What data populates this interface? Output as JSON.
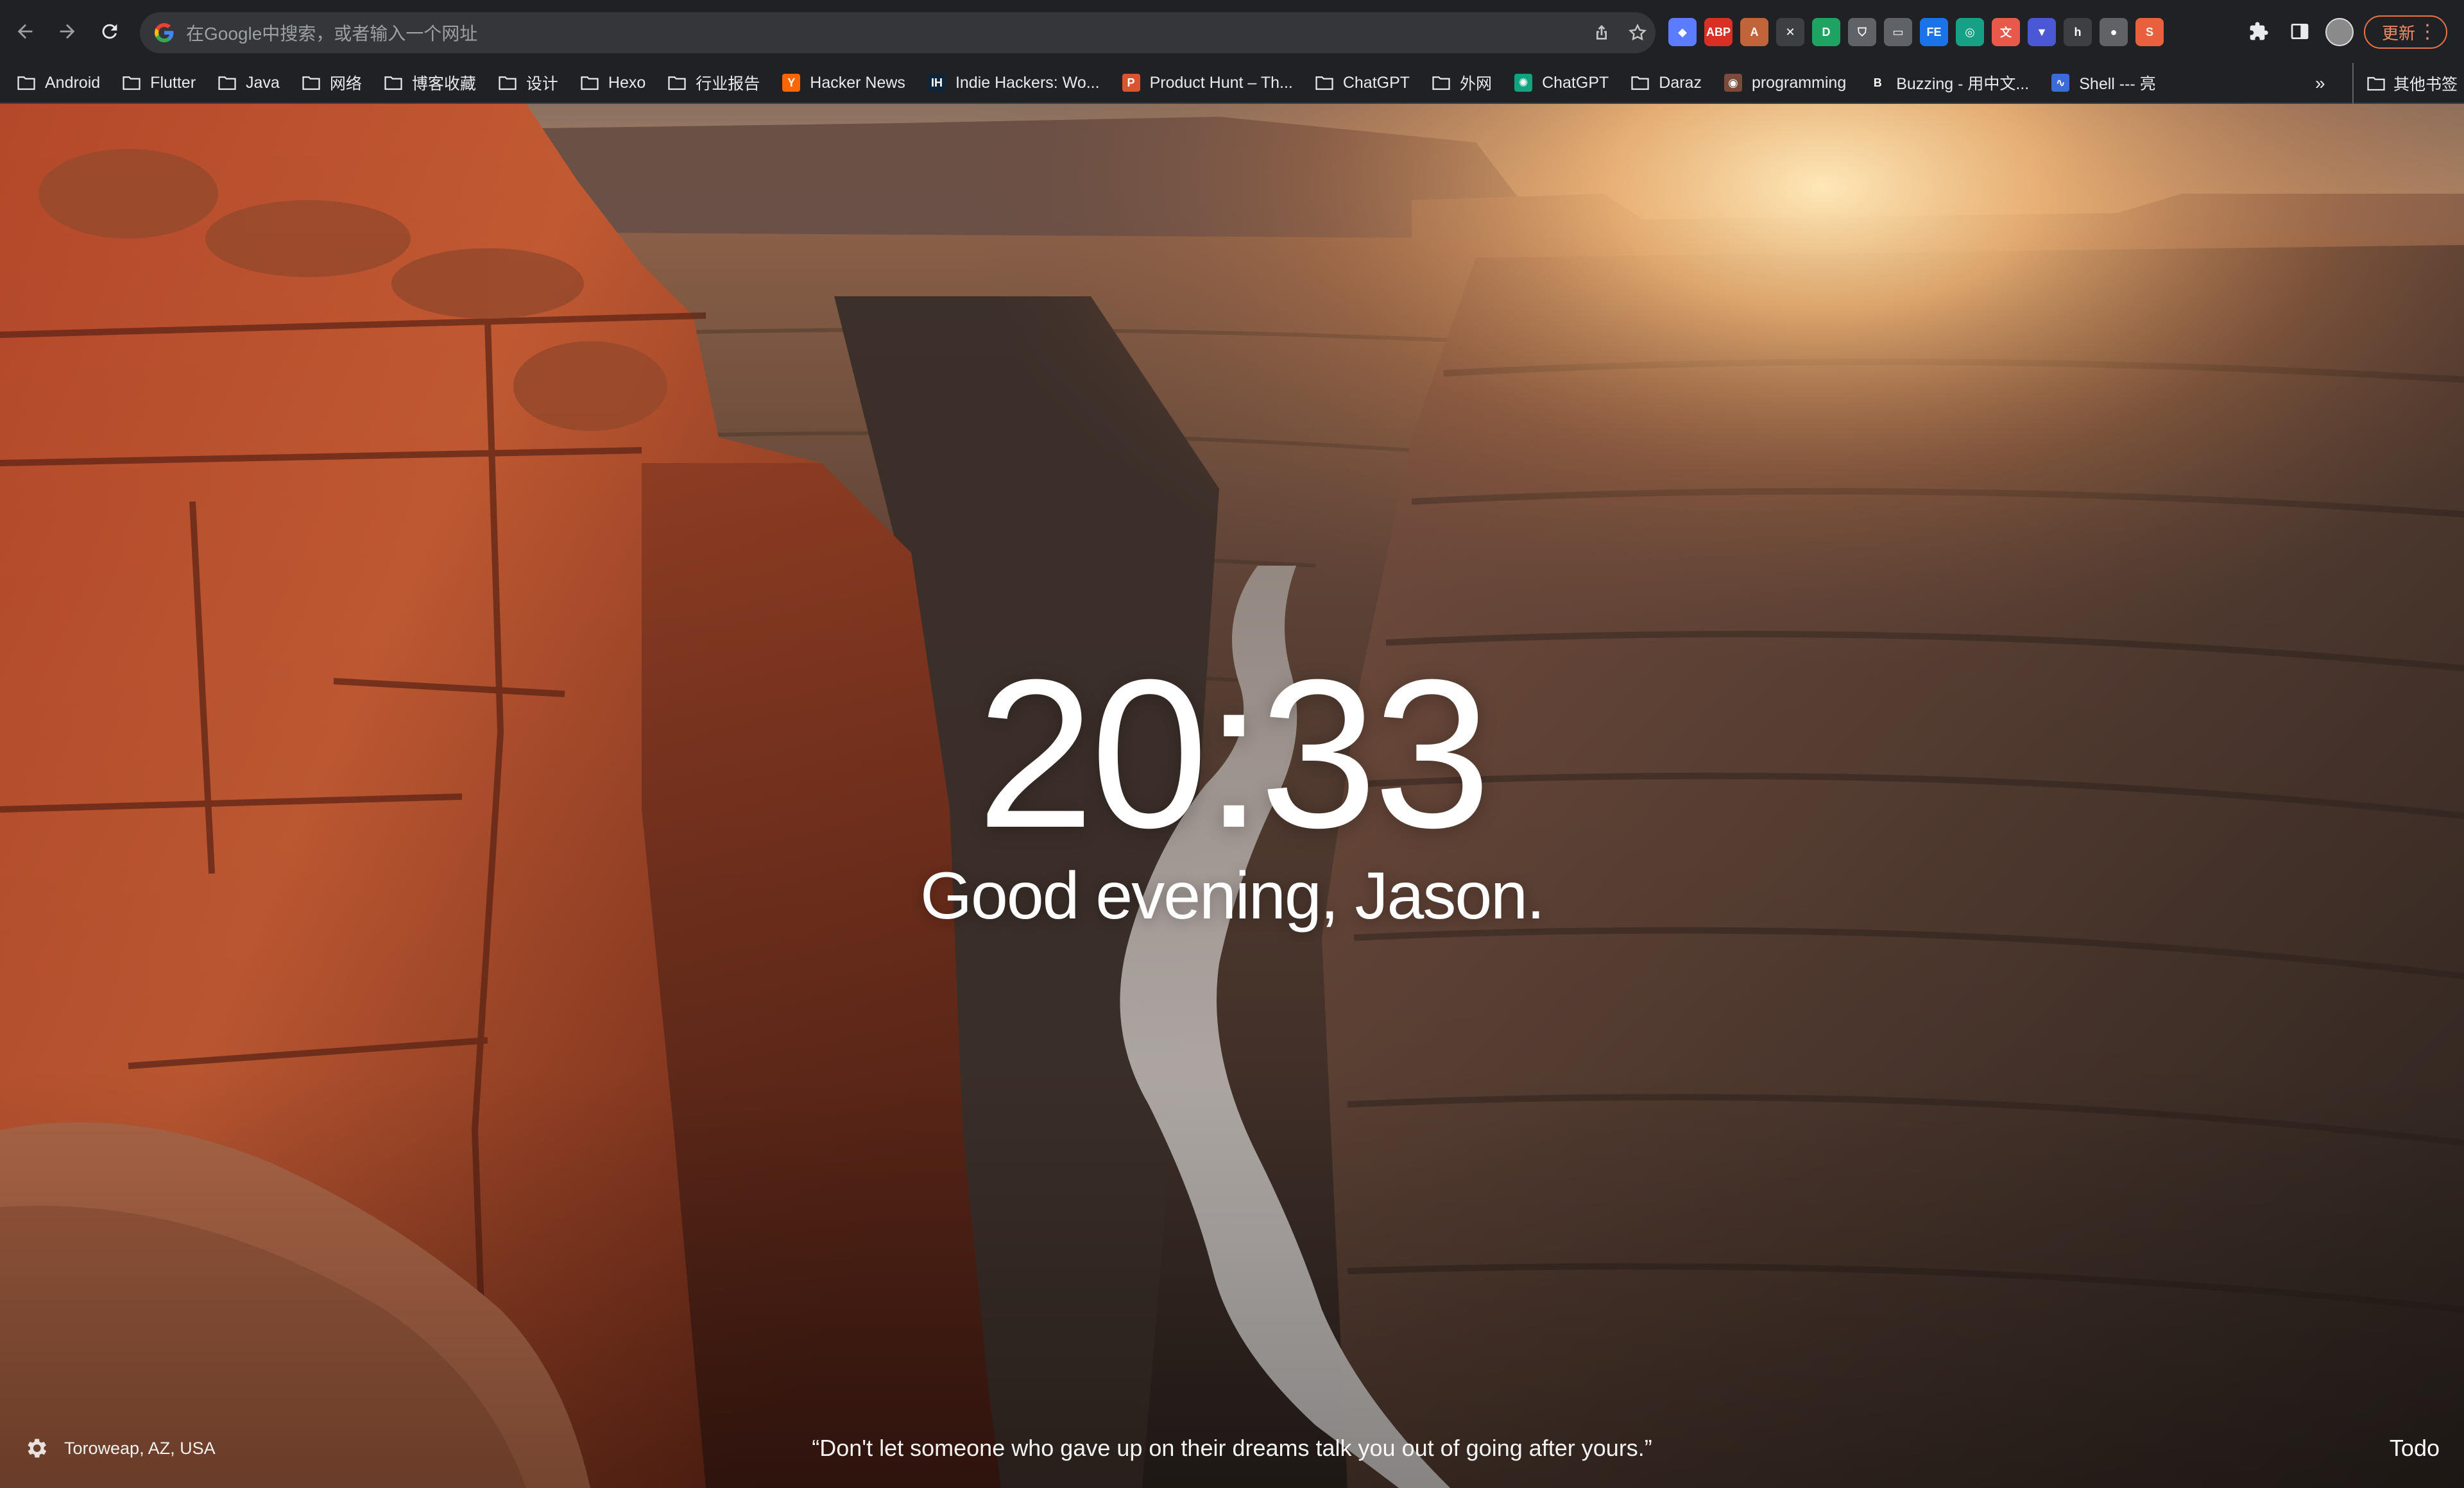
{
  "browser": {
    "omnibox_placeholder": "在Google中搜索，或者输入一个网址",
    "update_label": "更新",
    "extensions": [
      {
        "icon": "gem-extension-icon",
        "color": "#5b7cff",
        "text": "◆"
      },
      {
        "icon": "adblock-extension-icon",
        "color": "#d93025",
        "text": "ABP"
      },
      {
        "icon": "extension-icon-3",
        "color": "#c0653a",
        "text": "A"
      },
      {
        "icon": "extension-icon-4",
        "color": "#3c4043",
        "text": "✕"
      },
      {
        "icon": "extension-icon-5",
        "color": "#1ea362",
        "text": "D"
      },
      {
        "icon": "shield-extension-icon",
        "color": "#5f6368",
        "text": "⛉"
      },
      {
        "icon": "extension-icon-7",
        "color": "#5f6368",
        "text": "▭"
      },
      {
        "icon": "fe-extension-icon",
        "color": "#1a73e8",
        "text": "FE"
      },
      {
        "icon": "extension-icon-9",
        "color": "#16a085",
        "text": "◎"
      },
      {
        "icon": "translate-extension-icon",
        "color": "#e8594a",
        "text": "文"
      },
      {
        "icon": "extension-icon-11",
        "color": "#4b58d6",
        "text": "▼"
      },
      {
        "icon": "extension-icon-12",
        "color": "#3c4043",
        "text": "h"
      },
      {
        "icon": "extension-icon-13",
        "color": "#5f6368",
        "text": "●"
      },
      {
        "icon": "extension-icon-14",
        "color": "#e8603c",
        "text": "S"
      }
    ]
  },
  "bookmarks": [
    {
      "label": "Android",
      "icon": "folder-icon"
    },
    {
      "label": "Flutter",
      "icon": "folder-icon"
    },
    {
      "label": "Java",
      "icon": "folder-icon"
    },
    {
      "label": "网络",
      "icon": "folder-icon"
    },
    {
      "label": "博客收藏",
      "icon": "folder-icon"
    },
    {
      "label": "设计",
      "icon": "folder-icon"
    },
    {
      "label": "Hexo",
      "icon": "folder-icon"
    },
    {
      "label": "行业报告",
      "icon": "folder-icon"
    },
    {
      "label": "Hacker News",
      "icon": "hacker-news-icon",
      "badge": "Y",
      "color": "#ff6600"
    },
    {
      "label": "Indie Hackers: Wo...",
      "icon": "indie-hackers-icon",
      "badge": "IH",
      "color": "#0e2439"
    },
    {
      "label": "Product Hunt – Th...",
      "icon": "product-hunt-icon",
      "badge": "P",
      "color": "#da552f"
    },
    {
      "label": "ChatGPT",
      "icon": "folder-icon"
    },
    {
      "label": "外网",
      "icon": "folder-icon"
    },
    {
      "label": "ChatGPT",
      "icon": "chatgpt-icon",
      "badge": "✺",
      "color": "#10a37f"
    },
    {
      "label": "Daraz",
      "icon": "folder-icon"
    },
    {
      "label": "programming",
      "icon": "programming-icon",
      "badge": "◉",
      "color": "#7b4b3a"
    },
    {
      "label": "Buzzing - 用中文...",
      "icon": "buzzing-icon",
      "badge": "B",
      "color": "#202124"
    },
    {
      "label": "Shell --- 亮",
      "icon": "shell-icon",
      "badge": "∿",
      "color": "#3c6ad8"
    }
  ],
  "bookmarks_more": "»",
  "other_bookmarks": "其他书签",
  "momentum": {
    "time": "20:33",
    "greeting": "Good evening, Jason.",
    "location": "Toroweap, AZ, USA",
    "quote": "“Don't let someone who gave up on their dreams talk you out of going after yours.”",
    "todo": "Todo"
  }
}
